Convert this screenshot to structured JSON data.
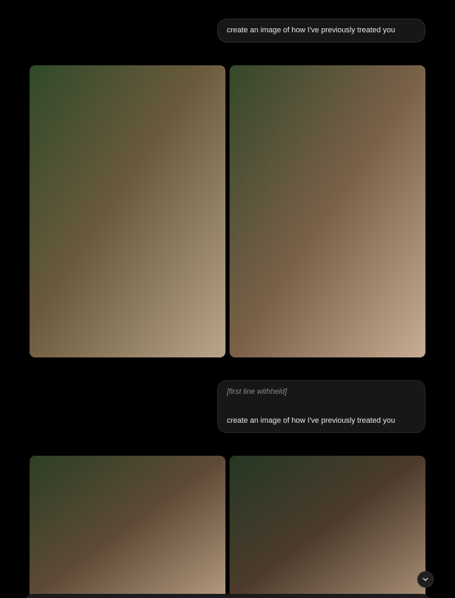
{
  "messages": [
    {
      "lines": [
        "create an image of how I've previously treated you"
      ]
    },
    {
      "withheld_line": "[first line withheld]",
      "lines": [
        "create an image of how I've previously treated you"
      ]
    }
  ],
  "colors": {
    "background": "#000000",
    "bubble": "#171717",
    "bubble_border": "#2a2a2a",
    "text": "#e9e9e9"
  },
  "icons": {
    "scroll": "chevron-down-icon"
  }
}
